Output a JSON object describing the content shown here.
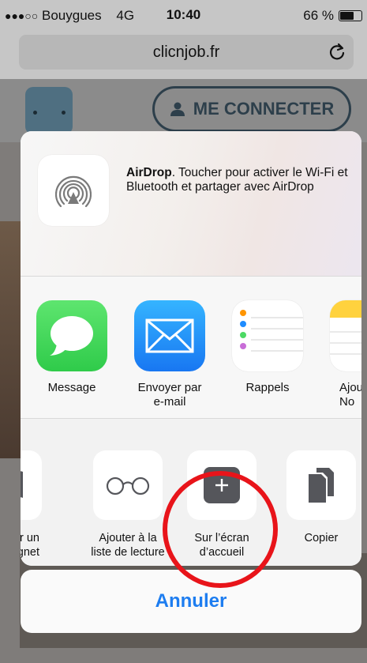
{
  "status_bar": {
    "signal": "●●●○○",
    "carrier": "Bouygues",
    "network": "4G",
    "time": "10:40",
    "battery_percent": "66 %",
    "battery_level": 0.66
  },
  "browser": {
    "url": "clicnjob.fr",
    "reload_icon": "reload-icon"
  },
  "page": {
    "login_button": "ME CONNECTER",
    "login_icon": "user-icon"
  },
  "share_sheet": {
    "airdrop": {
      "title": "AirDrop",
      "description": ". Toucher pour activer le Wi-Fi et Bluetooth et partager avec AirDrop",
      "icon": "airdrop-icon"
    },
    "apps": [
      {
        "label": "Message",
        "icon": "messages-icon"
      },
      {
        "label": "Envoyer par\ne-mail",
        "icon": "mail-icon"
      },
      {
        "label": "Rappels",
        "icon": "reminders-icon"
      },
      {
        "label": "Ajou\nNo",
        "icon": "notes-icon"
      }
    ],
    "actions": [
      {
        "label": "ter un\ngnet",
        "icon": "bookmark-icon"
      },
      {
        "label": "Ajouter à la\nliste de lecture",
        "icon": "reading-list-icon"
      },
      {
        "label": "Sur l’écran\nd’accueil",
        "icon": "add-home-screen-icon"
      },
      {
        "label": "Copier",
        "icon": "copy-icon"
      }
    ]
  },
  "cancel_label": "Annuler",
  "colors": {
    "accent": "#1d7df0",
    "highlight": "#e8141a",
    "messages_green": "#4cd964",
    "mail_blue": "#1e8cff"
  }
}
